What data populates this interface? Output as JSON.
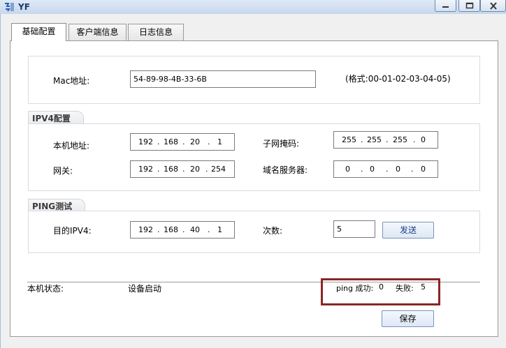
{
  "window": {
    "title": "YF"
  },
  "tabs": [
    {
      "label": "基础配置",
      "active": true
    },
    {
      "label": "客户端信息",
      "active": false
    },
    {
      "label": "日志信息",
      "active": false
    }
  ],
  "mac": {
    "label": "Mac地址:",
    "value": "54-89-98-4B-33-6B",
    "format_hint": "(格式:00-01-02-03-04-05)"
  },
  "ipv4": {
    "section_title": "IPV4配置",
    "local_ip": {
      "label": "本机地址:",
      "octets": [
        "192",
        "168",
        "20",
        "1"
      ]
    },
    "subnet_mask": {
      "label": "子网掩码:",
      "octets": [
        "255",
        "255",
        "255",
        "0"
      ]
    },
    "gateway": {
      "label": "网关:",
      "octets": [
        "192",
        "168",
        "20",
        "254"
      ]
    },
    "dns": {
      "label": "域名服务器:",
      "octets": [
        "0",
        "0",
        "0",
        "0"
      ]
    }
  },
  "ping": {
    "section_title": "PING测试",
    "target": {
      "label": "目的IPV4:",
      "octets": [
        "192",
        "168",
        "40",
        "1"
      ]
    },
    "count_label": "次数:",
    "count_value": "5",
    "send_label": "发送"
  },
  "status": {
    "label": "本机状态:",
    "value": "设备启动",
    "ping_success_label": "ping 成功:",
    "ping_success_value": "0",
    "fail_label": "失败:",
    "fail_value": "5"
  },
  "save_label": "保存",
  "colors": {
    "highlight_border": "#8a2525",
    "titlebar": "#c9d9ee"
  }
}
